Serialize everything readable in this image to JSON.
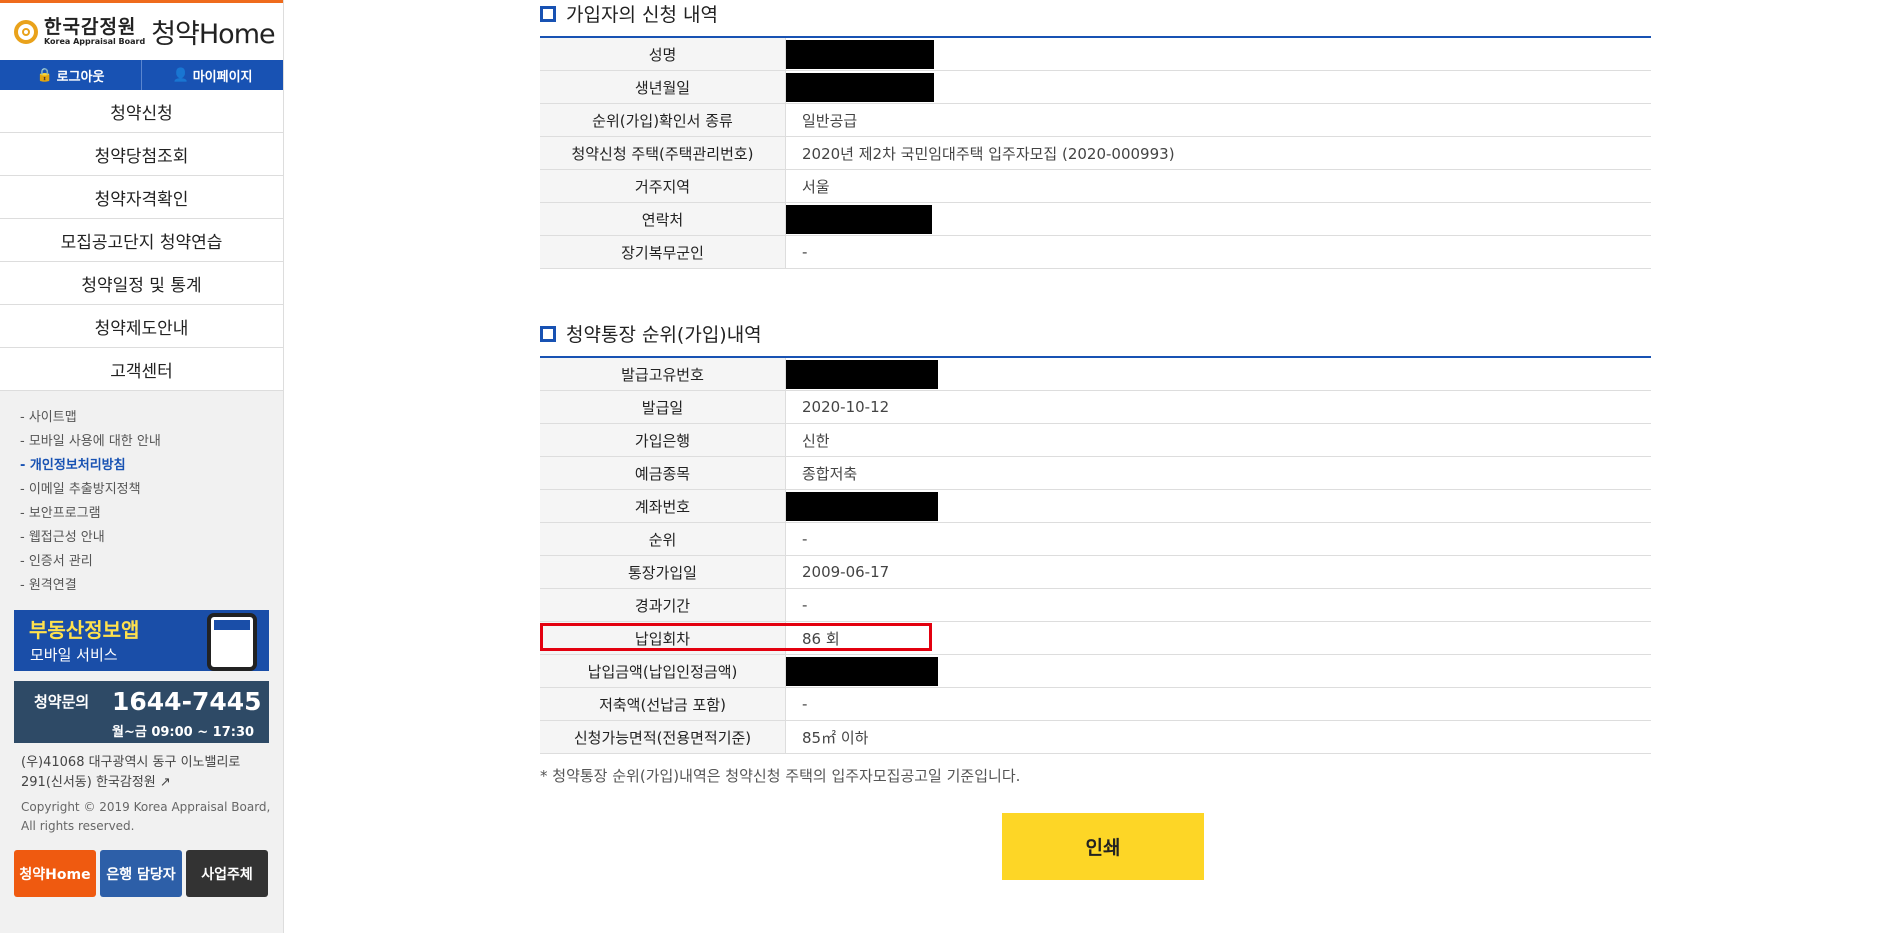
{
  "sidebar": {
    "logo": {
      "org_ko": "한국감정원",
      "org_en": "Korea Appraisal Board",
      "brand": "청약Home"
    },
    "top_buttons": {
      "logout": "로그아웃",
      "mypage": "마이페이지"
    },
    "menu": [
      "청약신청",
      "청약당첨조회",
      "청약자격확인",
      "모집공고단지 청약연습",
      "청약일정 및 통계",
      "청약제도안내",
      "고객센터"
    ],
    "links": [
      "- 사이트맵",
      "- 모바일 사용에 대한 안내",
      "- 개인정보처리방침",
      "- 이메일 추출방지정책",
      "- 보안프로그램",
      "- 웹접근성 안내",
      "- 인증서 관리",
      "- 원격연결"
    ],
    "banner_app": {
      "title": "부동산정보앱",
      "subtitle": "모바일 서비스"
    },
    "banner_contact": {
      "label": "청약문의",
      "phone": "1644-7445",
      "hours": "월~금 09:00 ~ 17:30"
    },
    "address_line1": "(우)41068 대구광역시 동구 이노밸리로",
    "address_line2": "291(신서동) 한국감정원",
    "copyright_line1": "Copyright © 2019 Korea Appraisal Board,",
    "copyright_line2": "All rights reserved.",
    "bottom_buttons": [
      "청약Home",
      "은행 담당자",
      "사업주체"
    ],
    "colors": {
      "accent_orange": "#ef6b1c",
      "primary_blue": "#1852b3",
      "dark": "#333333"
    }
  },
  "section1": {
    "title": "가입자의 신청 내역",
    "rows": [
      {
        "label": "성명",
        "value": ""
      },
      {
        "label": "생년월일",
        "value": ""
      },
      {
        "label": "순위(가입)확인서 종류",
        "value": "일반공급"
      },
      {
        "label": "청약신청 주택(주택관리번호)",
        "value": "2020년 제2차 국민임대주택 입주자모집 (2020-000993)"
      },
      {
        "label": "거주지역",
        "value": "서울"
      },
      {
        "label": "연락처",
        "value": ""
      },
      {
        "label": "장기복무군인",
        "value": "-"
      }
    ]
  },
  "section2": {
    "title": "청약통장 순위(가입)내역",
    "rows": [
      {
        "label": "발급고유번호",
        "value": ""
      },
      {
        "label": "발급일",
        "value": "2020-10-12"
      },
      {
        "label": "가입은행",
        "value": "신한"
      },
      {
        "label": "예금종목",
        "value": "종합저축"
      },
      {
        "label": "계좌번호",
        "value": ""
      },
      {
        "label": "순위",
        "value": "-"
      },
      {
        "label": "통장가입일",
        "value": "2009-06-17"
      },
      {
        "label": "경과기간",
        "value": "-"
      },
      {
        "label": "납입회차",
        "value": "86 회"
      },
      {
        "label": "납입금액(납입인정금액)",
        "value": ""
      },
      {
        "label": "저축액(선납금 포함)",
        "value": "-"
      },
      {
        "label": "신청가능면적(전용면적기준)",
        "value": "85㎡ 이하"
      }
    ],
    "note": "* 청약통장 순위(가입)내역은 청약신청 주택의 입주자모집공고일 기준입니다."
  },
  "print_button": "인쇄"
}
